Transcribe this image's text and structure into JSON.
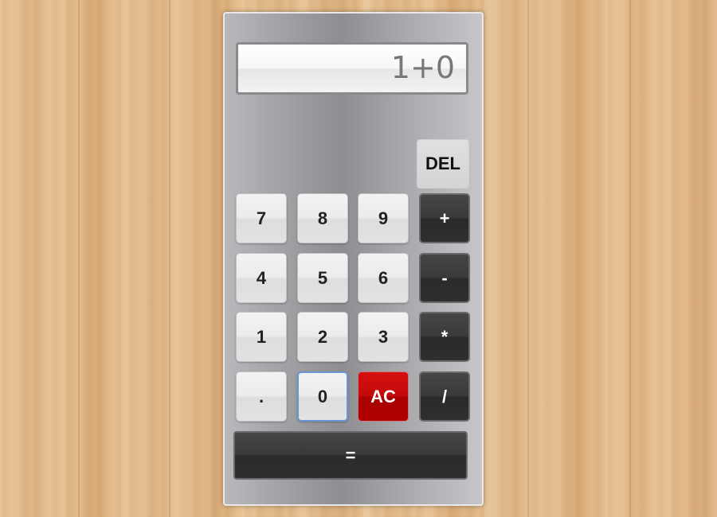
{
  "display": {
    "value": "1+0"
  },
  "keys": {
    "del": "DEL",
    "seven": "7",
    "eight": "8",
    "nine": "9",
    "plus": "+",
    "four": "4",
    "five": "5",
    "six": "6",
    "minus": "-",
    "one": "1",
    "two": "2",
    "three": "3",
    "multiply": "*",
    "dot": ".",
    "zero": "0",
    "clear": "AC",
    "divide": "/",
    "equals": "="
  },
  "colors": {
    "operator_key": "#333333",
    "clear_key": "#c40a0a",
    "digit_key": "#e8e8e8",
    "focus_ring": "#6a96d2"
  }
}
